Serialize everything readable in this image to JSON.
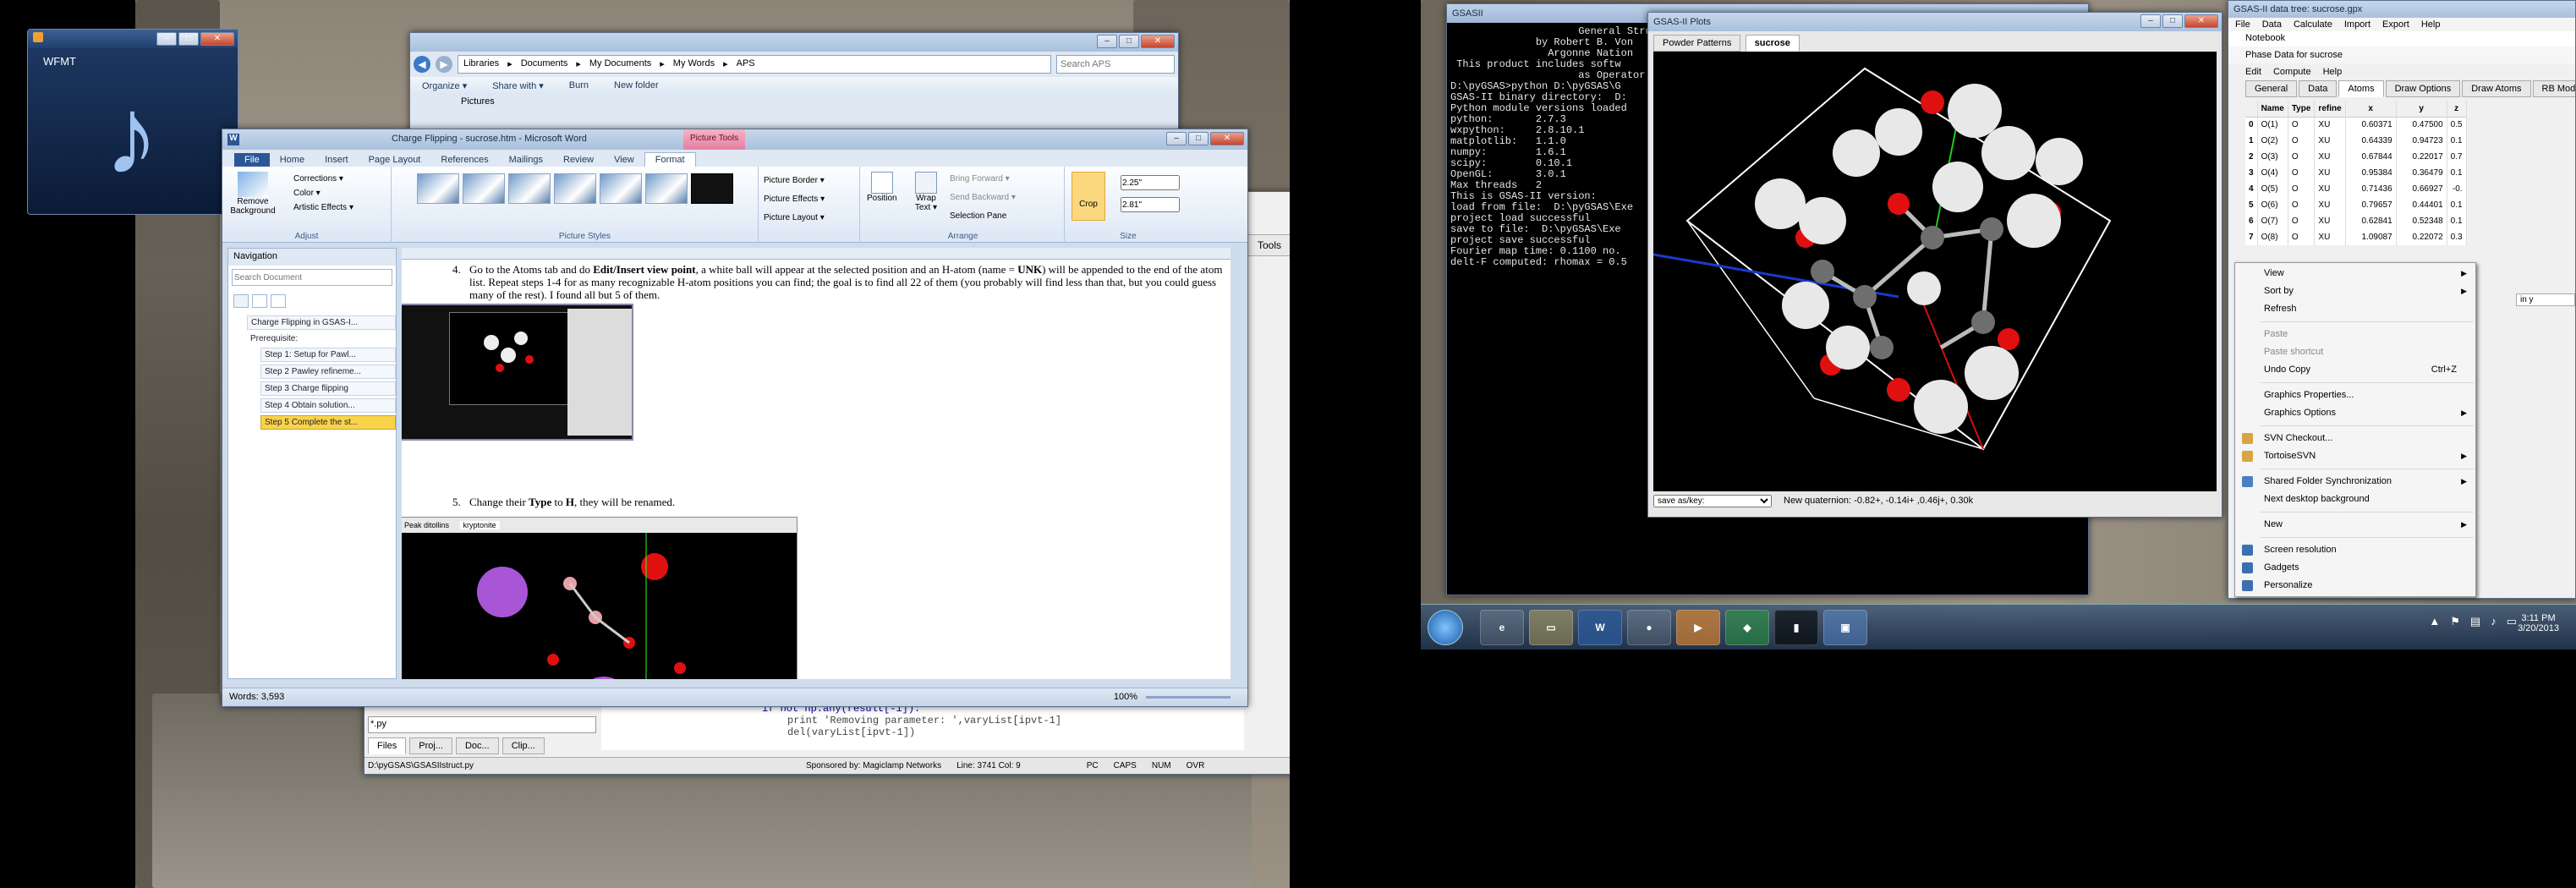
{
  "winamp_widget": {
    "title": "WFMT"
  },
  "explorer": {
    "breadcrumb": [
      "Libraries",
      "Documents",
      "My Documents",
      "My Words",
      "APS"
    ],
    "search_placeholder": "Search APS",
    "toolbar": [
      "Organize ▾",
      "Share with ▾",
      "Burn",
      "New folder"
    ],
    "first_file": "Pictures"
  },
  "word": {
    "title": "Charge Flipping - sucrose.htm - Microsoft Word",
    "context_tab": "Picture Tools",
    "tabs": [
      "File",
      "Home",
      "Insert",
      "Page Layout",
      "References",
      "Mailings",
      "Review",
      "View",
      "Format"
    ],
    "adjust": {
      "remove_bg": "Remove Background",
      "corrections": "Corrections ▾",
      "color": "Color ▾",
      "artistic": "Artistic Effects ▾",
      "label": "Adjust"
    },
    "styles_label": "Picture Styles",
    "picture_menu": [
      "Picture Border ▾",
      "Picture Effects ▾",
      "Picture Layout ▾"
    ],
    "arrange": {
      "position": "Position",
      "wrap": "Wrap Text ▾",
      "bring": "Bring Forward ▾",
      "send": "Send Backward ▾",
      "pane": "Selection Pane",
      "label": "Arrange"
    },
    "size": {
      "crop": "Crop",
      "height": "2.25\"",
      "width": "2.81\"",
      "label": "Size"
    },
    "nav": {
      "title": "Navigation",
      "search_placeholder": "Search Document",
      "items": [
        "Charge Flipping in GSAS-I...",
        "Prerequisite:",
        "Step 1: Setup for Pawl...",
        "Step 2 Pawley refineme...",
        "Step 3 Charge flipping",
        "Step 4 Obtain solution...",
        "Step 5 Complete the st..."
      ]
    },
    "doc": {
      "step4_num": "4.",
      "step4_a": "Go to the Atoms tab and do ",
      "step4_b": "Edit/Insert view point",
      "step4_c": ", a white ball will appear at the selected position and an H-atom (name = ",
      "step4_d": "UNK",
      "step4_e": ") will be appended to the end of the atom list. Repeat steps 1-4 for as many recognizable H-atom positions you can find; the goal is to find all 22 of them (you probably will find less than that, but you could guess many of the rest). I found all but 5 of them.",
      "step5_num": "5.",
      "step5_a": "Change their ",
      "step5_b": "Type",
      "step5_c": " to ",
      "step5_d": "H",
      "step5_e": ", they will be renamed.",
      "small_tabs": [
        "Peak ditollins",
        "kryptonite"
      ]
    },
    "status": {
      "words": "Words: 3,593",
      "zoom": "100%"
    }
  },
  "ide": {
    "right_label": "Tools",
    "code_lines": [
      "if not np.any(result[-1]):",
      "print 'Removing parameter: ',varyList[ipvt-1]",
      "del(varyList[ipvt-1])"
    ],
    "file_filter": "*.py",
    "tabs": [
      "Files",
      "Proj...",
      "Doc...",
      "Clip..."
    ],
    "status_path": "D:\\pyGSAS\\GSASIIstruct.py",
    "status_sponsor": "Sponsored by: Magiclamp Networks",
    "status_pos": "Line: 3741 Col: 9",
    "status_flags": [
      "PC",
      "CAPS",
      "NUM",
      "OVR"
    ]
  },
  "console": {
    "title": "GSASII",
    "lines": [
      "                     General Struct",
      "              by Robert B. Von",
      "                Argonne Nation",
      " This product includes softw",
      "                     as Operator of A",
      "",
      "D:\\pyGSAS>python D:\\pyGSAS\\G",
      "GSAS-II binary directory:  D:",
      "Python module versions loaded",
      "python:       2.7.3",
      "wxpython:     2.8.10.1",
      "matplotlib:   1.1.0",
      "numpy:        1.6.1",
      "scipy:        0.10.1",
      "OpenGL:       3.0.1",
      "Max threads   2",
      "This is GSAS-II version:",
      "load from file:  D:\\pyGSAS\\Exe",
      "project load successful",
      "save to file:  D:\\pyGSAS\\Exe",
      "project save successful",
      "Fourier map time: 0.1100 no.",
      "delt-F computed: rhomax = 0.5"
    ]
  },
  "gsas_plots": {
    "title": "GSAS-II Plots",
    "tabs": [
      "Powder Patterns",
      "sucrose"
    ],
    "status_select": "save as/key:",
    "status_text": "New quaternion: -0.82+, -0.14i+ ,0.46j+, 0.30k"
  },
  "data_tree": {
    "title": "GSAS-II data tree: sucrose.gpx",
    "menu": [
      "File",
      "Data",
      "Calculate",
      "Import",
      "Export",
      "Help"
    ],
    "notebook": "Notebook",
    "phase_title": "Phase Data for sucrose",
    "submenu": [
      "Edit",
      "Compute",
      "Help"
    ],
    "tabs": [
      "General",
      "Data",
      "Atoms",
      "Draw Options",
      "Draw Atoms",
      "RB Models",
      "M"
    ],
    "columns": [
      "",
      "Name",
      "Type",
      "refine",
      "x",
      "y",
      "z"
    ],
    "rows": [
      [
        "0",
        "O(1)",
        "O",
        "XU",
        "0.60371",
        "0.47500",
        "0.5"
      ],
      [
        "1",
        "O(2)",
        "O",
        "XU",
        "0.64339",
        "0.94723",
        "0.1"
      ],
      [
        "2",
        "O(3)",
        "O",
        "XU",
        "0.67844",
        "0.22017",
        "0.7"
      ],
      [
        "3",
        "O(4)",
        "O",
        "XU",
        "0.95384",
        "0.36479",
        "0.1"
      ],
      [
        "4",
        "O(5)",
        "O",
        "XU",
        "0.71436",
        "0.66927",
        "-0."
      ],
      [
        "5",
        "O(6)",
        "O",
        "XU",
        "0.79657",
        "0.44401",
        "0.1"
      ],
      [
        "6",
        "O(7)",
        "O",
        "XU",
        "0.62841",
        "0.52348",
        "0.1"
      ],
      [
        "7",
        "O(8)",
        "O",
        "XU",
        "1.09087",
        "0.22072",
        "0.3"
      ]
    ],
    "side_text": "in y"
  },
  "context_menu": {
    "items": [
      {
        "label": "View",
        "arrow": true
      },
      {
        "label": "Sort by",
        "arrow": true
      },
      {
        "label": "Refresh"
      },
      {
        "sep": true
      },
      {
        "label": "Paste",
        "disabled": true
      },
      {
        "label": "Paste shortcut",
        "disabled": true
      },
      {
        "label": "Undo Copy",
        "shortcut": "Ctrl+Z"
      },
      {
        "sep": true
      },
      {
        "label": "Graphics Properties..."
      },
      {
        "label": "Graphics Options",
        "arrow": true
      },
      {
        "sep": true
      },
      {
        "label": "SVN Checkout...",
        "icon": "#d9a441"
      },
      {
        "label": "TortoiseSVN",
        "arrow": true,
        "icon": "#d9a441"
      },
      {
        "sep": true
      },
      {
        "label": "Shared Folder Synchronization",
        "arrow": true,
        "icon": "#4a7fc1"
      },
      {
        "label": "Next desktop background"
      },
      {
        "sep": true
      },
      {
        "label": "New",
        "arrow": true
      },
      {
        "sep": true
      },
      {
        "label": "Screen resolution",
        "icon": "#3c6fb0"
      },
      {
        "label": "Gadgets",
        "icon": "#3c6fb0"
      },
      {
        "label": "Personalize",
        "icon": "#3c6fb0"
      }
    ]
  },
  "taskbar": {
    "time": "3:11 PM",
    "date": "3/20/2013"
  },
  "colors": {
    "oxygen": "#e01010",
    "carbon": "#6e6e6e",
    "hydrogen": "#e8e8e8",
    "potassium": "#a855d6"
  }
}
